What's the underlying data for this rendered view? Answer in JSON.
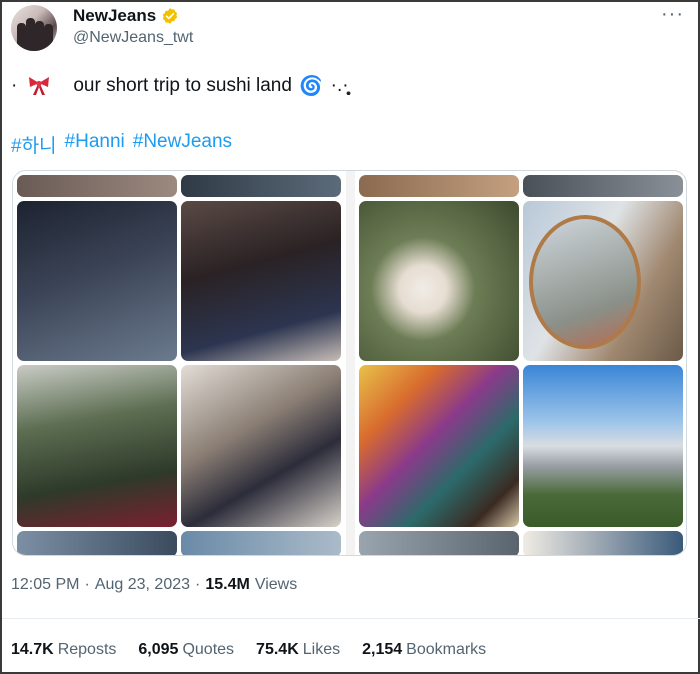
{
  "account": {
    "display_name": "NewJeans",
    "handle": "@NewJeans_twt",
    "verified_icon": "verified-badge-icon",
    "verified_color": "#f3c000"
  },
  "more_icon": "more-options-icon",
  "tweet": {
    "dot": "·",
    "bow_icon": "ribbon-bow-emoji",
    "text": "our short trip to sushi land",
    "spiral": "🌀",
    "tail": "·.·̥̥͙",
    "hashtags": [
      "#하니",
      "#Hanni",
      "#NewJeans"
    ]
  },
  "media": {
    "left_panel": [
      {
        "name": "street-night-photo",
        "colors": [
          "#2b3240",
          "#6b7a8e"
        ]
      },
      {
        "name": "girl-selfie-photo",
        "colors": [
          "#3d2f2c",
          "#9c8c88"
        ]
      },
      {
        "name": "girl-garden-photo",
        "colors": [
          "#3d4b38",
          "#7a8c6e"
        ]
      },
      {
        "name": "girl-doorway-photo",
        "colors": [
          "#6d6560",
          "#d0c8c0"
        ]
      }
    ],
    "right_panel": [
      {
        "name": "ice-cream-cup-photo",
        "colors": [
          "#4a5a3a",
          "#e8e4dc"
        ]
      },
      {
        "name": "round-mirror-photo",
        "colors": [
          "#d9dde0",
          "#7a6a58"
        ]
      },
      {
        "name": "paint-palette-photo",
        "colors": [
          "#d86a2e",
          "#2c6a6a"
        ]
      },
      {
        "name": "city-skyline-photo",
        "colors": [
          "#3a86d6",
          "#5a7a4a"
        ]
      }
    ]
  },
  "meta": {
    "time": "12:05 PM",
    "dot": "·",
    "date": "Aug 23, 2023",
    "views_count": "15.4M",
    "views_label": "Views"
  },
  "engagement": {
    "reposts_count": "14.7K",
    "reposts_label": "Reposts",
    "quotes_count": "6,095",
    "quotes_label": "Quotes",
    "likes_count": "75.4K",
    "likes_label": "Likes",
    "bookmarks_count": "2,154",
    "bookmarks_label": "Bookmarks"
  }
}
